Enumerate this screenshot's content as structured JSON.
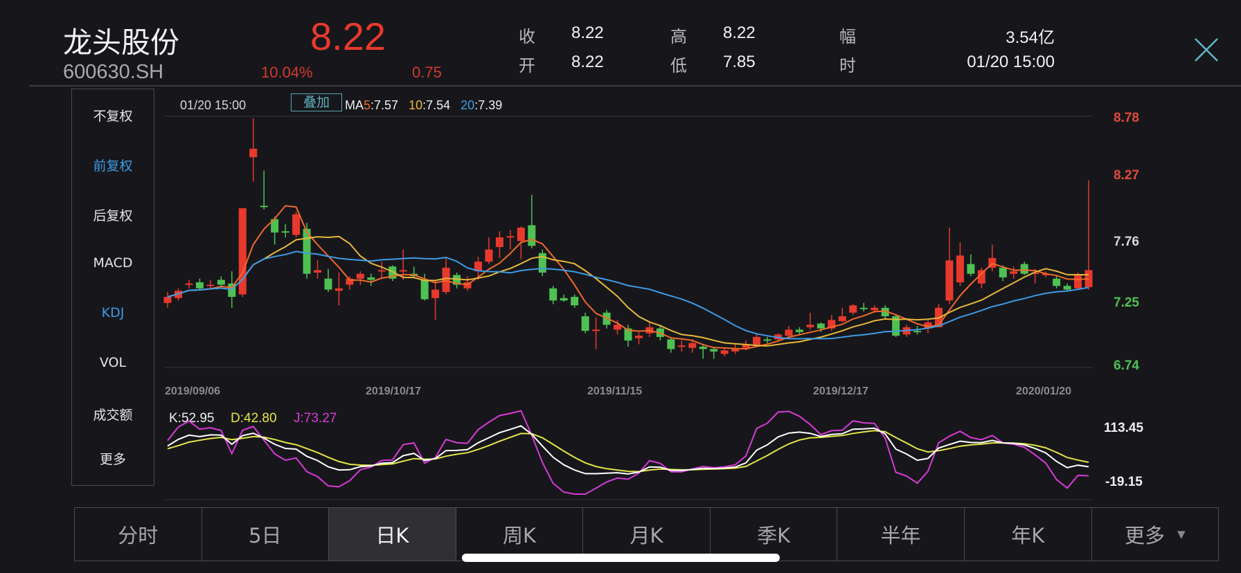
{
  "header": {
    "stock_name": "龙头股份",
    "stock_code": "600630.SH",
    "price": "8.22",
    "change_pct": "10.04%",
    "change_amt": "0.75",
    "stats": [
      {
        "label": "收",
        "value": "8.22"
      },
      {
        "label": "开",
        "value": "8.22"
      },
      {
        "label": "高",
        "value": "8.22"
      },
      {
        "label": "低",
        "value": "7.85"
      },
      {
        "label": "幅",
        "value": "3.54亿"
      },
      {
        "label": "时",
        "value": "01/20 15:00"
      }
    ],
    "close_icon": "close-icon"
  },
  "sidebar": {
    "items": [
      {
        "label": "不复权"
      },
      {
        "label": "前复权",
        "active": true
      },
      {
        "label": "后复权"
      },
      {
        "label": "MACD"
      },
      {
        "label": "KDJ",
        "active": true
      },
      {
        "label": "VOL"
      },
      {
        "label": "成交额"
      },
      {
        "label": "更多"
      }
    ]
  },
  "legend": {
    "time": "01/20 15:00",
    "overlay": "叠加",
    "ma_prefix": "MA",
    "ma5_label": "5",
    "ma5_value": ":7.57",
    "ma10_label": "10",
    "ma10_value": ":7.54",
    "ma20_label": "20",
    "ma20_value": ":7.39"
  },
  "colors": {
    "up": "#e8392d",
    "down": "#4fc153",
    "ma5": "#f06a2a",
    "ma10": "#e8b83a",
    "ma20": "#3d9be6",
    "k": "#ffffff",
    "d": "#e5e548",
    "j": "#d83ad8"
  },
  "chart_data": [
    {
      "type": "candlestick",
      "y_axis_labels": [
        "8.78",
        "8.27",
        "7.76",
        "7.25",
        "6.74"
      ],
      "ylim": [
        6.74,
        8.78
      ],
      "x_tick_labels": [
        "2019/09/06",
        "2019/10/17",
        "2019/11/15",
        "2019/12/17",
        "2020/01/20"
      ],
      "ohlc": [
        [
          7.26,
          7.35,
          7.22,
          7.31
        ],
        [
          7.3,
          7.38,
          7.28,
          7.36
        ],
        [
          7.41,
          7.45,
          7.38,
          7.42
        ],
        [
          7.43,
          7.46,
          7.36,
          7.38
        ],
        [
          7.4,
          7.45,
          7.37,
          7.41
        ],
        [
          7.45,
          7.48,
          7.39,
          7.41
        ],
        [
          7.42,
          7.52,
          7.22,
          7.31
        ],
        [
          7.33,
          8.04,
          7.31,
          8.04
        ],
        [
          8.46,
          8.78,
          8.26,
          8.53
        ],
        [
          8.06,
          8.35,
          8.03,
          8.05
        ],
        [
          7.95,
          7.97,
          7.74,
          7.84
        ],
        [
          7.85,
          7.91,
          7.8,
          7.84
        ],
        [
          7.82,
          8.01,
          7.8,
          7.99
        ],
        [
          7.87,
          7.92,
          7.46,
          7.5
        ],
        [
          7.51,
          7.61,
          7.46,
          7.53
        ],
        [
          7.46,
          7.54,
          7.35,
          7.37
        ],
        [
          7.36,
          7.51,
          7.24,
          7.38
        ],
        [
          7.41,
          7.48,
          7.37,
          7.46
        ],
        [
          7.46,
          7.52,
          7.41,
          7.5
        ],
        [
          7.47,
          7.5,
          7.4,
          7.45
        ],
        [
          7.52,
          7.6,
          7.47,
          7.53
        ],
        [
          7.56,
          7.57,
          7.44,
          7.46
        ],
        [
          7.52,
          7.7,
          7.45,
          7.53
        ],
        [
          7.5,
          7.56,
          7.47,
          7.48
        ],
        [
          7.45,
          7.5,
          7.28,
          7.29
        ],
        [
          7.3,
          7.44,
          7.12,
          7.37
        ],
        [
          7.35,
          7.63,
          7.33,
          7.55
        ],
        [
          7.49,
          7.51,
          7.38,
          7.41
        ],
        [
          7.38,
          7.48,
          7.36,
          7.43
        ],
        [
          7.52,
          7.64,
          7.45,
          7.6
        ],
        [
          7.6,
          7.8,
          7.58,
          7.7
        ],
        [
          7.72,
          7.85,
          7.63,
          7.8
        ],
        [
          7.8,
          7.86,
          7.7,
          7.81
        ],
        [
          7.77,
          7.89,
          7.62,
          7.88
        ],
        [
          7.9,
          8.15,
          7.71,
          7.73
        ],
        [
          7.67,
          7.7,
          7.48,
          7.51
        ],
        [
          7.38,
          7.4,
          7.25,
          7.28
        ],
        [
          7.3,
          7.33,
          7.27,
          7.28
        ],
        [
          7.31,
          7.33,
          7.22,
          7.24
        ],
        [
          7.15,
          7.18,
          7.01,
          7.03
        ],
        [
          7.03,
          7.14,
          6.88,
          7.04
        ],
        [
          7.18,
          7.2,
          7.05,
          7.08
        ],
        [
          7.04,
          7.12,
          7.0,
          7.08
        ],
        [
          7.05,
          7.08,
          6.9,
          6.95
        ],
        [
          6.97,
          7.02,
          6.92,
          6.99
        ],
        [
          7.01,
          7.1,
          6.98,
          7.06
        ],
        [
          7.05,
          7.08,
          6.95,
          6.98
        ],
        [
          6.96,
          6.98,
          6.85,
          6.88
        ],
        [
          6.9,
          6.95,
          6.86,
          6.91
        ],
        [
          6.89,
          6.96,
          6.85,
          6.93
        ],
        [
          6.9,
          6.92,
          6.8,
          6.88
        ],
        [
          6.88,
          6.9,
          6.8,
          6.86
        ],
        [
          6.84,
          6.89,
          6.82,
          6.87
        ],
        [
          6.86,
          6.92,
          6.84,
          6.88
        ],
        [
          6.89,
          6.95,
          6.87,
          6.92
        ],
        [
          6.91,
          7.0,
          6.9,
          6.98
        ],
        [
          6.96,
          6.98,
          6.93,
          6.95
        ],
        [
          6.96,
          7.01,
          6.94,
          7.0
        ],
        [
          6.99,
          7.07,
          6.97,
          7.04
        ],
        [
          7.04,
          7.06,
          7.0,
          7.02
        ],
        [
          7.06,
          7.18,
          7.04,
          7.08
        ],
        [
          7.09,
          7.1,
          7.02,
          7.05
        ],
        [
          7.05,
          7.16,
          7.03,
          7.12
        ],
        [
          7.11,
          7.22,
          7.1,
          7.15
        ],
        [
          7.18,
          7.25,
          7.16,
          7.24
        ],
        [
          7.22,
          7.26,
          7.19,
          7.21
        ],
        [
          7.2,
          7.24,
          7.19,
          7.22
        ],
        [
          7.22,
          7.24,
          7.13,
          7.15
        ],
        [
          7.15,
          7.16,
          6.98,
          6.99
        ],
        [
          7.0,
          7.08,
          6.98,
          7.06
        ],
        [
          7.03,
          7.07,
          7.0,
          7.02
        ],
        [
          7.05,
          7.12,
          7.01,
          7.1
        ],
        [
          7.06,
          7.25,
          7.06,
          7.22
        ],
        [
          7.28,
          7.88,
          7.25,
          7.61
        ],
        [
          7.43,
          7.76,
          7.4,
          7.65
        ],
        [
          7.58,
          7.66,
          7.48,
          7.5
        ],
        [
          7.42,
          7.55,
          7.38,
          7.53
        ],
        [
          7.55,
          7.74,
          7.52,
          7.63
        ],
        [
          7.55,
          7.57,
          7.44,
          7.47
        ],
        [
          7.5,
          7.56,
          7.46,
          7.52
        ],
        [
          7.58,
          7.6,
          7.49,
          7.5
        ],
        [
          7.5,
          7.54,
          7.42,
          7.51
        ],
        [
          7.49,
          7.52,
          7.47,
          7.5
        ],
        [
          7.46,
          7.48,
          7.38,
          7.4
        ],
        [
          7.4,
          7.42,
          7.36,
          7.37
        ],
        [
          7.38,
          7.51,
          7.37,
          7.49
        ],
        [
          7.39,
          8.27,
          7.37,
          7.53
        ]
      ]
    },
    {
      "type": "line",
      "name": "KDJ",
      "k_label": "K:52.95",
      "d_label": "D:42.80",
      "j_label": "J:73.27",
      "y_axis_labels": [
        "113.45",
        "-19.15"
      ],
      "ylim": [
        -19.15,
        113.45
      ]
    }
  ],
  "tabs": [
    {
      "label": "分时"
    },
    {
      "label": "5日"
    },
    {
      "label": "日K",
      "active": true
    },
    {
      "label": "周K"
    },
    {
      "label": "月K"
    },
    {
      "label": "季K"
    },
    {
      "label": "半年"
    },
    {
      "label": "年K"
    },
    {
      "label": "更多",
      "caret": "▼"
    }
  ]
}
